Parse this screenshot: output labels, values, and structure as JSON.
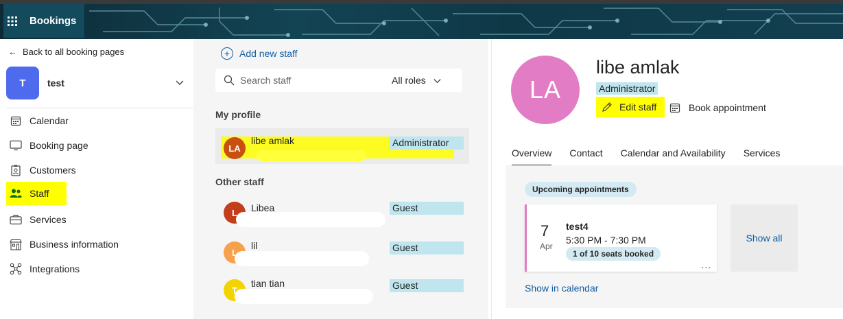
{
  "app": {
    "title": "Bookings"
  },
  "nav": {
    "back_label": "Back to all booking pages",
    "business": {
      "initial": "T",
      "name": "test"
    },
    "items": [
      {
        "label": "Calendar",
        "icon": "calendar-icon"
      },
      {
        "label": "Booking page",
        "icon": "monitor-icon"
      },
      {
        "label": "Customers",
        "icon": "contact-card-icon"
      },
      {
        "label": "Staff",
        "icon": "people-icon",
        "active": true
      },
      {
        "label": "Services",
        "icon": "briefcase-icon"
      },
      {
        "label": "Business information",
        "icon": "building-icon"
      },
      {
        "label": "Integrations",
        "icon": "integrations-icon"
      }
    ]
  },
  "staff_list": {
    "add_label": "Add new staff",
    "search_placeholder": "Search staff",
    "roles_filter": "All roles",
    "my_profile_heading": "My profile",
    "other_staff_heading": "Other staff",
    "me": {
      "initials": "LA",
      "name": "libe amlak",
      "role": "Administrator",
      "color": "#ca5010"
    },
    "others": [
      {
        "initials": "L",
        "name": "Libea",
        "role": "Guest",
        "color": "#c43e1c"
      },
      {
        "initials": "L",
        "name": "lil",
        "role": "Guest",
        "color": "#f7a14a"
      },
      {
        "initials": "T",
        "name": "tian tian",
        "role": "Guest",
        "color": "#f3d400"
      }
    ]
  },
  "profile": {
    "initials": "LA",
    "name": "libe amlak",
    "role": "Administrator",
    "edit_label": "Edit staff",
    "book_label": "Book appointment",
    "avatar_color": "#e27cc4",
    "tabs": [
      "Overview",
      "Contact",
      "Calendar and Availability",
      "Services"
    ],
    "selected_tab": "Overview",
    "upcoming_label": "Upcoming appointments",
    "appointment": {
      "day": "7",
      "month": "Apr",
      "title": "test4",
      "time": "5:30 PM - 7:30 PM",
      "seats": "1 of 10 seats booked",
      "more": "..."
    },
    "show_all_label": "Show all",
    "show_calendar_label": "Show in calendar"
  },
  "colors": {
    "accent_link": "#115ea3",
    "highlight": "#ffff00",
    "role_tag": "#bfe5ef",
    "business_avatar": "#4f6bed"
  }
}
